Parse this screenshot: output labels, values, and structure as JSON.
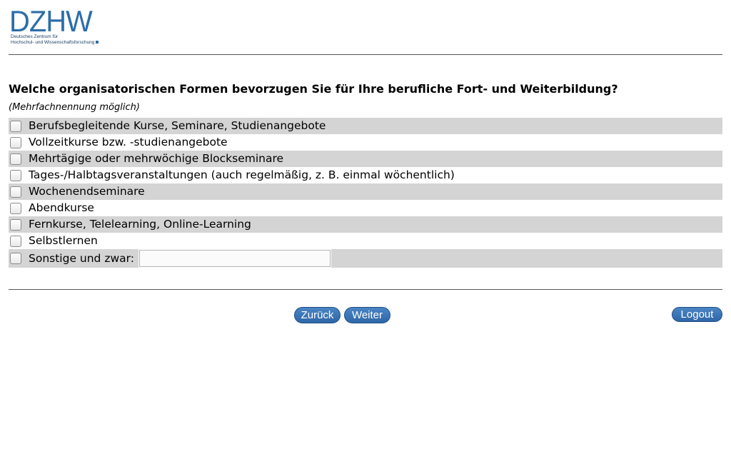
{
  "logo": {
    "word": "DZHW",
    "line1": "Deutsches Zentrum für",
    "line2": "Hochschul- und Wissenschaftsforschung",
    "color": "#2c6ea8"
  },
  "question": {
    "text": "Welche organisatorischen Formen bevorzugen Sie für Ihre berufliche Fort- und Weiterbildung?",
    "hint": "(Mehrfachnennung möglich)"
  },
  "options": [
    {
      "label": "Berufsbegleitende Kurse, Seminare, Studienangebote",
      "checked": false
    },
    {
      "label": "Vollzeitkurse bzw. -studienangebote",
      "checked": false
    },
    {
      "label": "Mehrtägige oder mehrwöchige Blockseminare",
      "checked": false
    },
    {
      "label": "Tages-/Halbtagsveranstaltungen (auch regelmäßig, z. B. einmal wöchentlich)",
      "checked": false
    },
    {
      "label": "Wochenendseminare",
      "checked": false
    },
    {
      "label": "Abendkurse",
      "checked": false
    },
    {
      "label": "Fernkurse, Telelearning, Online-Learning",
      "checked": false
    },
    {
      "label": "Selbstlernen",
      "checked": false
    }
  ],
  "other": {
    "label": "Sonstige und zwar:",
    "value": "",
    "checked": false
  },
  "nav": {
    "back": "Zurück",
    "next": "Weiter",
    "logout": "Logout"
  },
  "colors": {
    "row_shade": "#d4d4d4",
    "button": "#3a75b6"
  }
}
